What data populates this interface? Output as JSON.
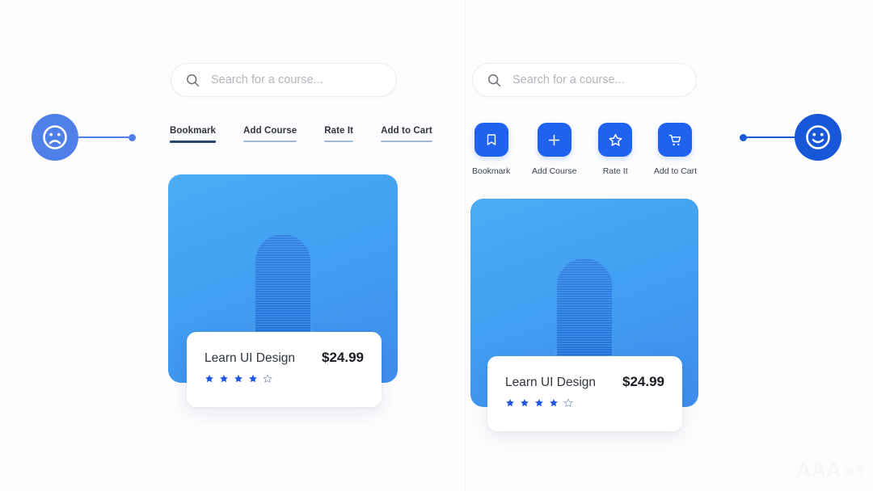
{
  "background": {
    "page_color": "#fcfcfd",
    "panel_color": "#fdfcfe"
  },
  "markers": {
    "left": {
      "icon": "sad-face-icon",
      "color": "#4f7fe8",
      "meaning": "bad-example"
    },
    "right": {
      "icon": "happy-face-icon",
      "color": "#1758d8",
      "meaning": "good-example"
    }
  },
  "left_variant": {
    "search": {
      "icon": "search-icon",
      "placeholder": "Search for a course...",
      "value": ""
    },
    "nav_links": [
      {
        "label": "Bookmark",
        "active": true
      },
      {
        "label": "Add Course",
        "active": false
      },
      {
        "label": "Rate It",
        "active": false
      },
      {
        "label": "Add to Cart",
        "active": false
      }
    ],
    "product": {
      "title": "Learn UI Design",
      "price": "$24.99",
      "rating": 4,
      "rating_max": 5,
      "card_color": "#41a3f0"
    }
  },
  "right_variant": {
    "search": {
      "icon": "search-icon",
      "placeholder": "Search for a course...",
      "value": ""
    },
    "action_buttons": [
      {
        "label": "Bookmark",
        "icon": "bookmark-icon"
      },
      {
        "label": "Add Course",
        "icon": "plus-icon"
      },
      {
        "label": "Rate It",
        "icon": "star-icon"
      },
      {
        "label": "Add to Cart",
        "icon": "cart-icon"
      }
    ],
    "button_color": "#1f62f0",
    "product": {
      "title": "Learn UI Design",
      "price": "$24.99",
      "rating": 4,
      "rating_max": 5,
      "card_color": "#41a3f0"
    }
  },
  "watermark": {
    "text": "AAA",
    "subtext": "教育"
  }
}
